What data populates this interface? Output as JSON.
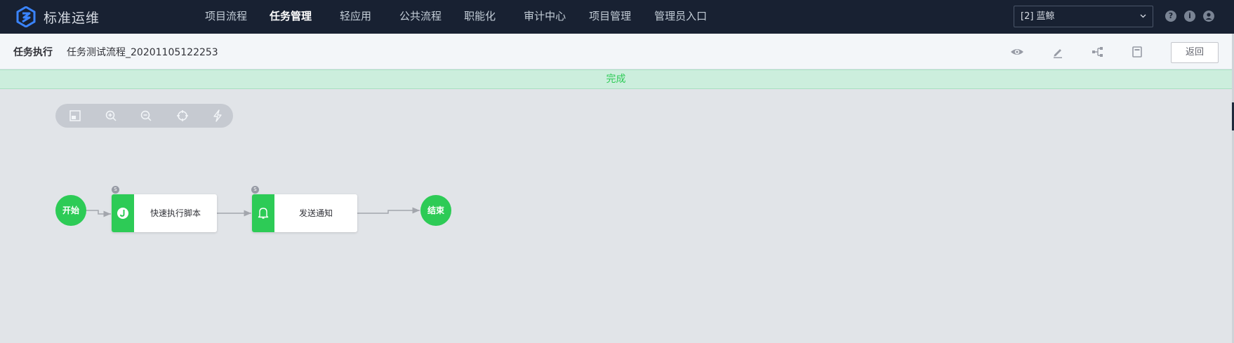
{
  "brand": {
    "title": "标准运维",
    "logo_icon": "bk-sops-logo-icon"
  },
  "nav": {
    "items": [
      {
        "label": "项目流程",
        "active": false
      },
      {
        "label": "任务管理",
        "active": true
      },
      {
        "label": "轻应用",
        "active": false
      },
      {
        "label": "公共流程",
        "active": false
      },
      {
        "label": "职能化",
        "active": false
      },
      {
        "label": "审计中心",
        "active": false
      },
      {
        "label": "项目管理",
        "active": false
      },
      {
        "label": "管理员入口",
        "active": false
      }
    ],
    "project_select": "[2] 蓝鲸",
    "icons": [
      "help-icon",
      "info-icon",
      "user-icon"
    ]
  },
  "header": {
    "title": "任务执行",
    "task_name": "任务测试流程_20201105122253",
    "icons": [
      "eye-icon",
      "edit-icon",
      "flow-tree-icon",
      "document-icon"
    ],
    "back_label": "返回"
  },
  "status": {
    "text": "完成",
    "color": "#2dcb56"
  },
  "toolbar": {
    "icons": [
      "thumbnail-icon",
      "zoom-in-icon",
      "zoom-out-icon",
      "reset-position-icon",
      "quick-run-icon"
    ]
  },
  "flow": {
    "start_label": "开始",
    "end_label": "结束",
    "tasks": [
      {
        "label": "快速执行脚本",
        "icon": "job-icon",
        "badge": "S"
      },
      {
        "label": "发送通知",
        "icon": "bell-icon",
        "badge": "S"
      }
    ],
    "node_color": "#2dcb56"
  },
  "colors": {
    "nav_bg": "#182132",
    "canvas_bg": "#e1e4e8",
    "accent": "#2dcb56"
  }
}
